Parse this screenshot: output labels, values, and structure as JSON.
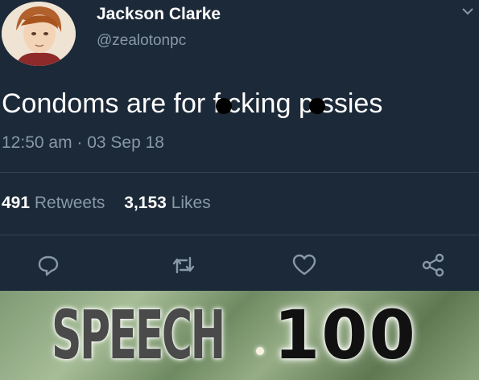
{
  "tweet": {
    "author_name": "Jackson Clarke",
    "author_handle": "@zealotonpc",
    "text_part1": "Condoms are for f",
    "text_part2": "cking p",
    "text_part3": "ssies",
    "timestamp": "12:50 am · 03 Sep 18",
    "retweets_count": "491",
    "retweets_label": "Retweets",
    "likes_count": "3,153",
    "likes_label": "Likes"
  },
  "meme": {
    "skill_label": "SPEECH",
    "skill_value": "100"
  },
  "colors": {
    "background": "#1c2938",
    "secondary_text": "#8899a6",
    "divider": "#38444d"
  }
}
